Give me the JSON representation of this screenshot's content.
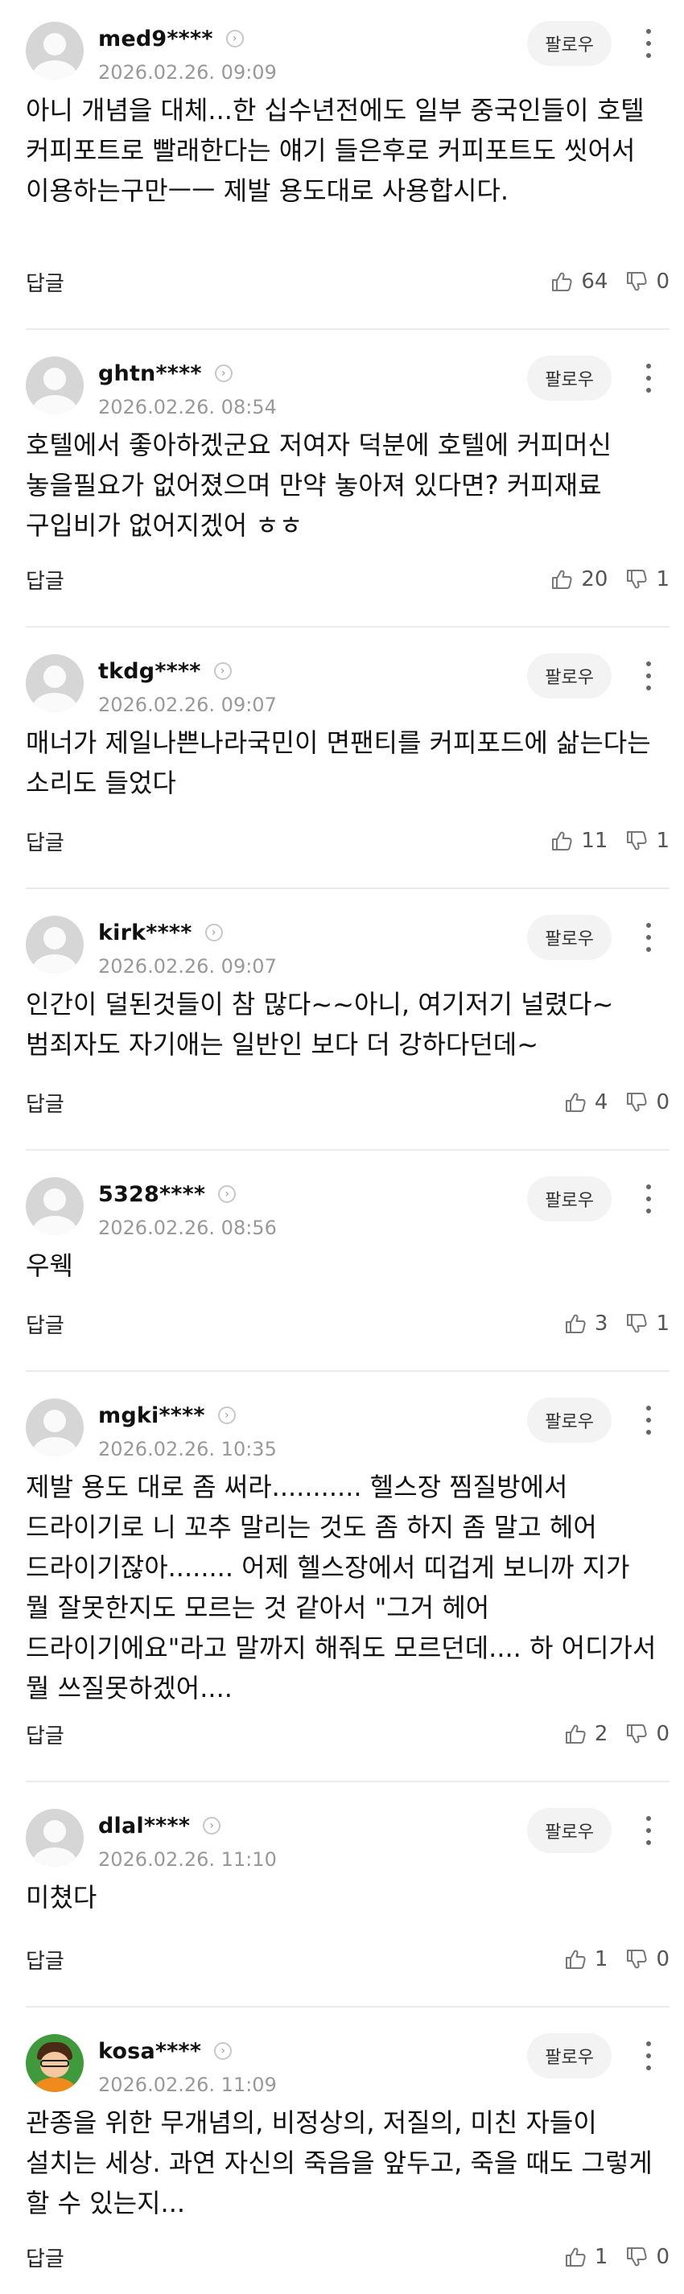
{
  "follow_label": "팔로우",
  "reply_label": "답글",
  "comments": [
    {
      "user": "med9****",
      "time": "2026.02.26. 09:09",
      "avatar": "default-avatar",
      "text": "아니 개념을 대체...한 십수년전에도 일부 중국인들이 호텔 커피포트로 빨래한다는 얘기 들은후로 커피포트도 씻어서 이용하는구만ㅡㅡ 제발 용도대로 사용합시다.",
      "likes": "64",
      "dislikes": "0"
    },
    {
      "user": "ghtn****",
      "time": "2026.02.26. 08:54",
      "avatar": "default-avatar",
      "text": "호텔에서 좋아하겠군요 저여자 덕분에 호텔에 커피머신 놓을필요가 없어졌으며 만약 놓아져 있다면? 커피재료 구입비가 없어지겠어 ㅎㅎ",
      "likes": "20",
      "dislikes": "1"
    },
    {
      "user": "tkdg****",
      "time": "2026.02.26. 09:07",
      "avatar": "default-avatar",
      "text": "매너가 제일나쁜나라국민이 면팬티를 커피포드에 삶는다는 소리도 들었다",
      "likes": "11",
      "dislikes": "1"
    },
    {
      "user": "kirk****",
      "time": "2026.02.26. 09:07",
      "avatar": "default-avatar",
      "text": "인간이 덜된것들이 참 많다~~아니, 여기저기 널렸다~ 범죄자도 자기애는 일반인 보다 더 강하다던데~",
      "likes": "4",
      "dislikes": "0"
    },
    {
      "user": "5328****",
      "time": "2026.02.26. 08:56",
      "avatar": "default-avatar",
      "text": "우웩",
      "likes": "3",
      "dislikes": "1"
    },
    {
      "user": "mgki****",
      "time": "2026.02.26. 10:35",
      "avatar": "default-avatar",
      "text": "제발 용도 대로 좀 써라........... 헬스장 찜질방에서 드라이기로 니 꼬추 말리는 것도 좀 하지 좀 말고 헤어 드라이기잖아........ 어제 헬스장에서 띠겁게 보니까 지가 뭘 잘못한지도 모르는 것 같아서 \"그거 헤어 드라이기에요\"라고 말까지 해줘도 모르던데.... 하 어디가서 뭘 쓰질못하겠어....",
      "likes": "2",
      "dislikes": "0"
    },
    {
      "user": "dlal****",
      "time": "2026.02.26. 11:10",
      "avatar": "default-avatar",
      "text": "미쳤다",
      "likes": "1",
      "dislikes": "0"
    },
    {
      "user": "kosa****",
      "time": "2026.02.26. 11:09",
      "avatar": "cartoon-avatar",
      "text": "관종을 위한 무개념의, 비정상의, 저질의, 미친 자들이 설치는 세상. 과연 자신의 죽음을 앞두고, 죽을 때도 그렇게 할 수 있는지...",
      "likes": "1",
      "dislikes": "0"
    }
  ]
}
